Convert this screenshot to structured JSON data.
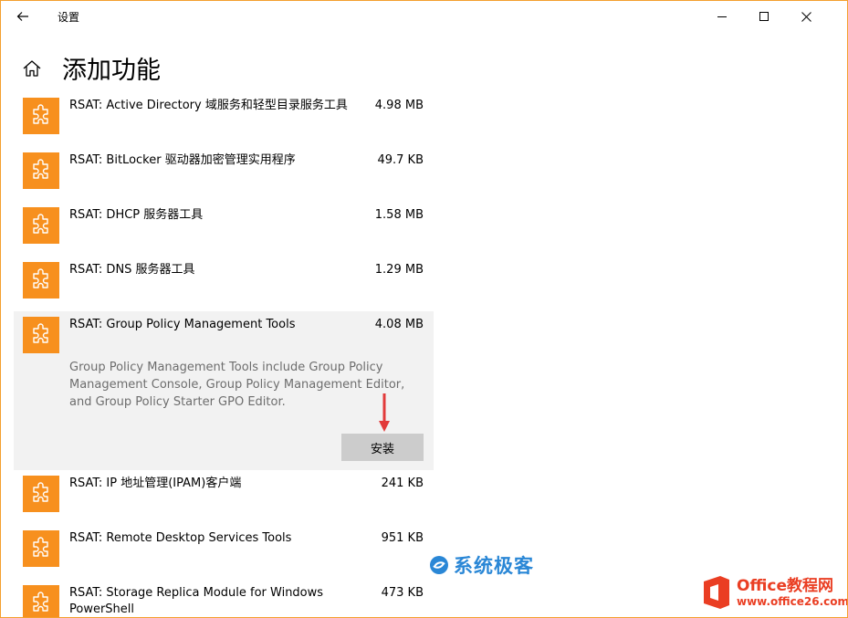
{
  "window": {
    "title": "设置",
    "accent": "#f4a02e"
  },
  "header": {
    "title": "添加功能"
  },
  "list": {
    "items": [
      {
        "name": "RSAT: Active Directory 域服务和轻型目录服务工具",
        "size": "4.98 MB"
      },
      {
        "name": "RSAT: BitLocker 驱动器加密管理实用程序",
        "size": "49.7 KB"
      },
      {
        "name": "RSAT: DHCP 服务器工具",
        "size": "1.58 MB"
      },
      {
        "name": "RSAT: DNS 服务器工具",
        "size": "1.29 MB"
      },
      {
        "name": "RSAT: Group Policy Management Tools",
        "size": "4.08 MB",
        "description": "Group Policy Management Tools include Group Policy Management Console, Group Policy Management Editor, and Group Policy Starter GPO Editor.",
        "install_label": "安装"
      },
      {
        "name": "RSAT: IP 地址管理(IPAM)客户端",
        "size": "241 KB"
      },
      {
        "name": "RSAT: Remote Desktop Services Tools",
        "size": "951 KB"
      },
      {
        "name": "RSAT: Storage Replica Module for Windows PowerShell",
        "size": "473 KB"
      }
    ],
    "tile_color": "#f7901e",
    "icon": "puzzle-icon"
  },
  "watermarks": {
    "xitong": "系统极客",
    "office_line1": "Office教程网",
    "office_line2": "www.office26.com"
  }
}
